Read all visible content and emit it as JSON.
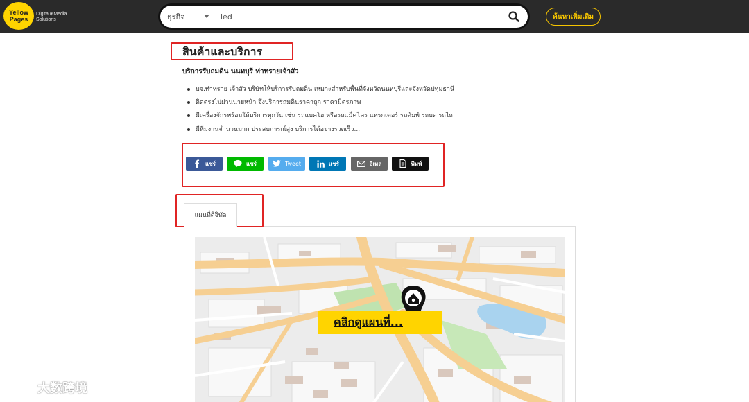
{
  "header": {
    "logo_line1": "Yellow",
    "logo_line2": "Pages",
    "logo_sub1": "Digital⊕Media",
    "logo_sub2": "Solutions",
    "category_value": "ธุรกิจ",
    "search_value": "led",
    "more_search_label": "ค้นหาเพิ่มเติม"
  },
  "content": {
    "section_title": "สินค้าและบริการ",
    "subtitle": "บริการรับถมดิน นนทบุรี ท่าทรายเจ้าสัว",
    "bullets": [
      "บจ.ท่าทราย เจ้าสัว บริษัทให้บริการรับถมดิน เหมาะสำหรับพื้นที่จังหวัดนนทบุรีและจังหวัดปทุมธานี",
      "ติดตรงไม่ผ่านนายหน้า จึงบริการถมดินราคาถูก ราคามิตรภาพ",
      "มีเครื่องจักรพร้อมให้บริการทุกวัน เช่น รถแบคโฮ หรือรถแม็คโคร แทรกเตอร์ รถดัมพ์ รถบด รถไถ",
      "มีทีมงานจำนวนมาก ประสบการณ์สูง บริการได้อย่างรวดเร็ว..."
    ]
  },
  "share": {
    "facebook": {
      "label": "แชร์",
      "icon": "facebook-icon",
      "color": "#3b5998"
    },
    "line": {
      "label": "แชร์",
      "icon": "line-icon",
      "color": "#00b900"
    },
    "twitter": {
      "label": "Tweet",
      "icon": "twitter-icon",
      "color": "#55acee"
    },
    "linkedin": {
      "label": "แชร์",
      "icon": "linkedin-icon",
      "color": "#0077b5"
    },
    "email": {
      "label": "อีเมล",
      "icon": "mail-icon",
      "color": "#666666"
    },
    "print": {
      "label": "พิมพ์",
      "icon": "print-icon",
      "color": "#111111"
    }
  },
  "map": {
    "tab_label": "แผนที่ดิจิทัล",
    "cta_label": "คลิกดูแผนที่..."
  },
  "watermark": {
    "text": "大数跨境"
  },
  "colors": {
    "header_bg": "#2a2a2a",
    "brand_yellow": "#ffd400",
    "highlight_red": "#e02424"
  }
}
